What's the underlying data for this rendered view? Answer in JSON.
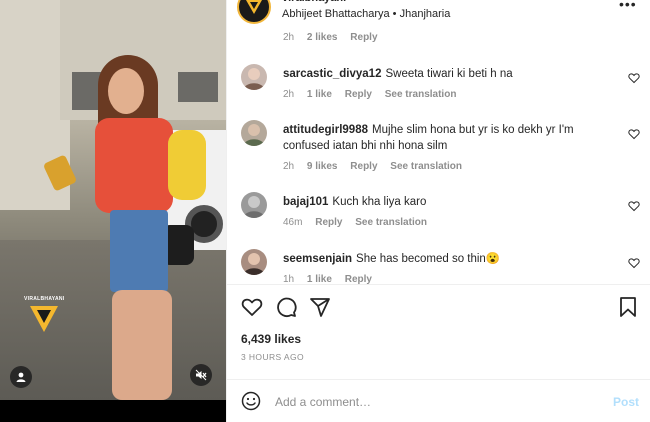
{
  "post": {
    "username": "viralbhayani",
    "subtitle": "Abhijeet Bhattacharya • Jhanjharia",
    "likes": "6,439 likes",
    "time_ago": "3 HOURS AGO"
  },
  "media": {
    "watermark": "VIRALBHAYANI"
  },
  "comments": [
    {
      "time": "2h",
      "likes": "2 likes",
      "reply": "Reply"
    },
    {
      "user": "sarcastic_divya12",
      "text": "Sweeta tiwari ki beti h na",
      "time": "2h",
      "likes": "1 like",
      "reply": "Reply",
      "translation": "See translation",
      "avatar_color": "#c9b8b0"
    },
    {
      "user": "attitudegirl9988",
      "text": "Mujhe slim hona but yr is ko dekh yr I'm confused iatan bhi nhi hona silm",
      "time": "2h",
      "likes": "9 likes",
      "reply": "Reply",
      "translation": "See translation",
      "avatar_color": "#b4a89a"
    },
    {
      "user": "bajaj101",
      "text": "Kuch kha liya karo",
      "time": "46m",
      "reply": "Reply",
      "translation": "See translation",
      "avatar_color": "#9a9a9a"
    },
    {
      "user": "seemsenjain",
      "text": "She has becomed so thin😮",
      "time": "1h",
      "likes": "1 like",
      "reply": "Reply",
      "avatar_color": "#a88d80"
    }
  ],
  "add_comment": {
    "placeholder": "Add a comment…",
    "post_label": "Post"
  },
  "colors": {
    "link": "#0095f6",
    "post_disabled": "#b2dffc",
    "muted": "#8e8e8e",
    "text": "#262626"
  }
}
